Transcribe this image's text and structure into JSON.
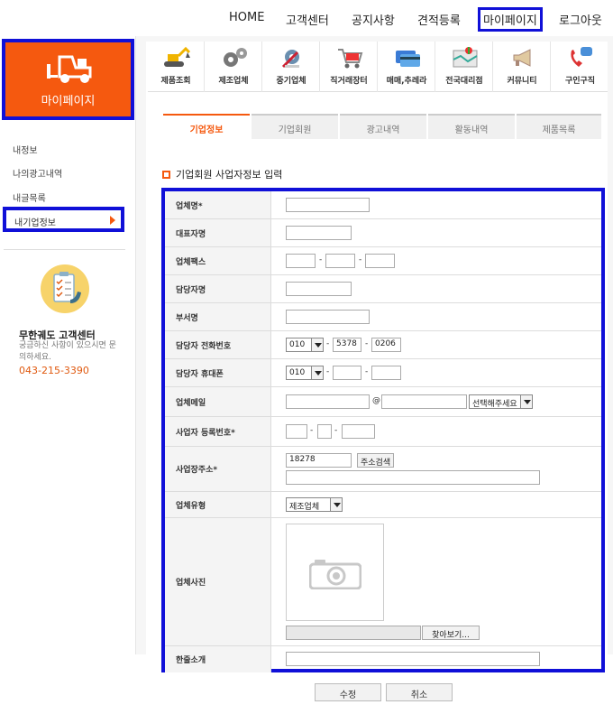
{
  "top_nav": [
    "HOME",
    "고객센터",
    "공지사항",
    "견적등록",
    "마이페이지",
    "로그아웃"
  ],
  "mypage": {
    "title": "마이페이지"
  },
  "sidebar": {
    "items": [
      "내정보",
      "나의광고내역",
      "내글목록",
      "내기업정보"
    ],
    "cs_title": "무한궤도 고객센터",
    "cs_desc": "궁금하신 사항이 있으시면 문의하세요.",
    "cs_phone": "043-215-3390"
  },
  "icon_menu": [
    "제품조회",
    "제조업체",
    "중기업체",
    "직거래장터",
    "매매,추레라",
    "전국대리점",
    "커뮤니티",
    "구인구직"
  ],
  "tabs": [
    "기업정보",
    "기업회원",
    "광고내역",
    "활동내역",
    "제품목록"
  ],
  "section_title": "기업회원 사업자정보 입력",
  "form": {
    "labels": {
      "company_name": "업체명*",
      "ceo_name": "대표자명",
      "fax": "업체팩스",
      "manager_name": "담당자명",
      "department": "부서명",
      "manager_phone": "담당자 전화번호",
      "manager_mobile": "담당자 휴대폰",
      "email": "업체메일",
      "biz_number": "사업자 등록번호*",
      "address": "사업장주소*",
      "company_type": "업체유형",
      "photo": "업체사진",
      "intro": "한줄소개"
    },
    "phone": {
      "area": "010",
      "mid": "5378",
      "last": "0206"
    },
    "mobile": {
      "area": "010"
    },
    "email_at": "@",
    "email_domain_placeholder": "선택해주세요",
    "zipcode": "18278",
    "address_search_label": "주소검색",
    "company_type_value": "제조업체",
    "browse_label": "찾아보기..."
  },
  "buttons": {
    "edit": "수정",
    "cancel": "취소"
  },
  "colors": {
    "accent": "#f5590f",
    "highlight": "#1010d8"
  }
}
